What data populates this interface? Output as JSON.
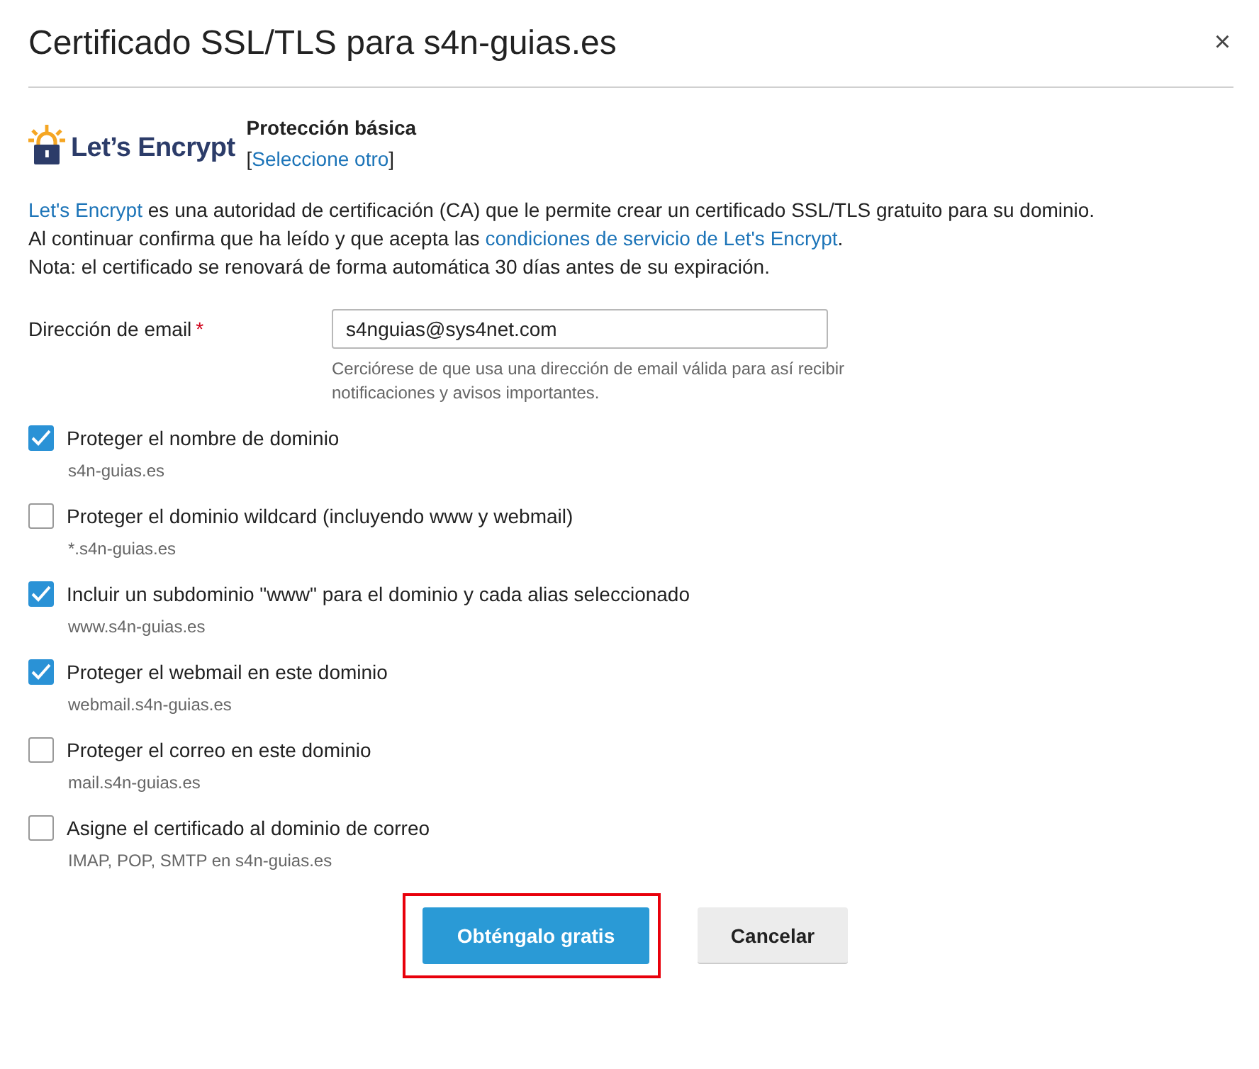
{
  "dialog": {
    "title": "Certificado SSL/TLS para s4n-guias.es",
    "close": "×"
  },
  "provider": {
    "logo_text": "Let’s Encrypt",
    "plan": "Protección básica",
    "bracket_open": "[",
    "change_link": "Seleccione otro",
    "bracket_close": "]"
  },
  "description": [
    [
      {
        "text": "Let's Encrypt",
        "link": true
      },
      {
        "text": " es una autoridad de certificación (CA) que le permite crear un certificado SSL/TLS gratuito para su dominio.",
        "link": false
      }
    ],
    [
      {
        "text": "Al continuar confirma que ha leído y que acepta las ",
        "link": false
      },
      {
        "text": "condiciones de servicio de Let's Encrypt",
        "link": true
      },
      {
        "text": ".",
        "link": false
      }
    ],
    [
      {
        "text": "Nota: el certificado se renovará de forma automática 30 días antes de su expiración.",
        "link": false
      }
    ]
  ],
  "email": {
    "label": "Dirección de email",
    "required_mark": "*",
    "value": "s4nguias@sys4net.com",
    "hint": "Cerciórese de que usa una dirección de email válida para así recibir notificaciones y avisos importantes."
  },
  "options": [
    {
      "label": "Proteger el nombre de dominio",
      "detail": "s4n-guias.es",
      "checked": true
    },
    {
      "label": "Proteger el dominio wildcard (incluyendo www y webmail)",
      "detail": "*.s4n-guias.es",
      "checked": false
    },
    {
      "label": "Incluir un subdominio \"www\" para el dominio y cada alias seleccionado",
      "detail": "www.s4n-guias.es",
      "checked": true
    },
    {
      "label": "Proteger el webmail en este dominio",
      "detail": "webmail.s4n-guias.es",
      "checked": true
    },
    {
      "label": "Proteger el correo en este dominio",
      "detail": "mail.s4n-guias.es",
      "checked": false
    },
    {
      "label": "Asigne el certificado al dominio de correo",
      "detail": "IMAP, POP, SMTP en s4n-guias.es",
      "checked": false
    }
  ],
  "buttons": [
    {
      "label": "Obténgalo gratis",
      "kind": "primary",
      "highlighted": true
    },
    {
      "label": "Cancelar",
      "kind": "secondary",
      "highlighted": false
    }
  ]
}
